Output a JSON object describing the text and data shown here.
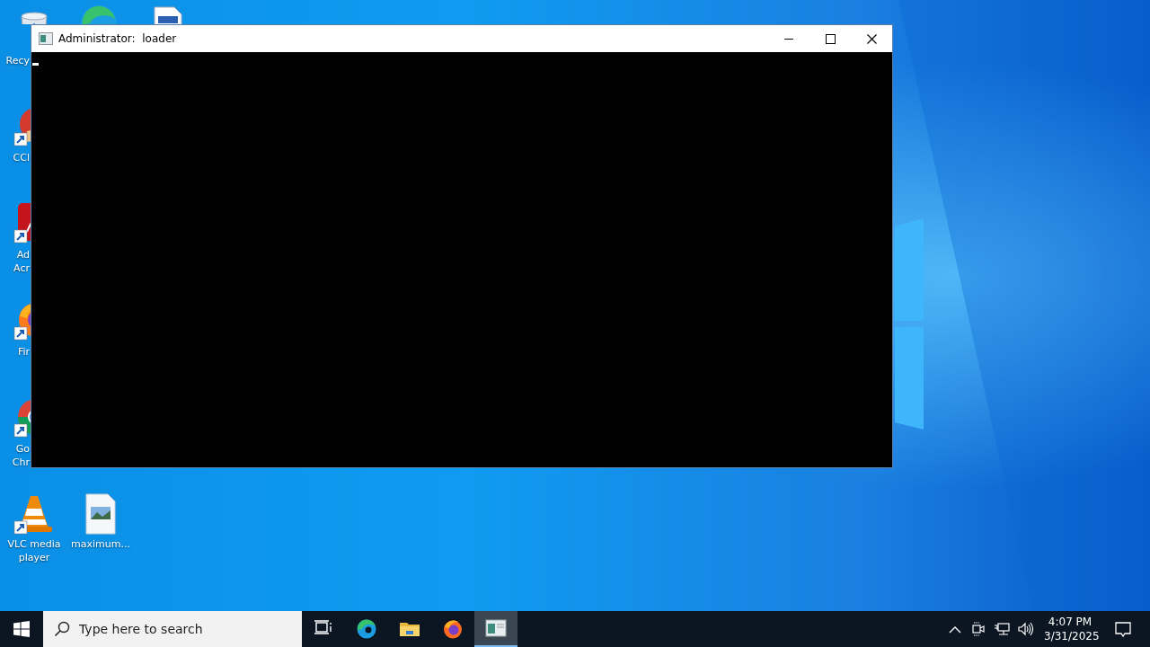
{
  "desktop_icons": [
    {
      "kind": "recycle-bin",
      "label_lines": [
        "Recy"
      ]
    },
    {
      "kind": "edge"
    },
    {
      "kind": "document"
    },
    {
      "kind": "ccleaner",
      "label_lines": [
        "CCl"
      ]
    },
    {
      "kind": "acrobat",
      "label_lines": [
        "Ad",
        "Acr"
      ]
    },
    {
      "kind": "firefox",
      "label_lines": [
        "Fir"
      ]
    },
    {
      "kind": "chrome",
      "label_lines": [
        "Go",
        "Chr"
      ]
    },
    {
      "kind": "vlc",
      "label_lines": [
        "VLC media",
        "player"
      ]
    },
    {
      "kind": "image-file",
      "label_lines": [
        "maximum..."
      ]
    }
  ],
  "window": {
    "title": "Administrator:  loader",
    "cursor": true
  },
  "taskbar": {
    "search": {
      "placeholder": "Type here to search"
    },
    "apps": [
      {
        "kind": "task-view",
        "selected": false
      },
      {
        "kind": "edge",
        "selected": false
      },
      {
        "kind": "explorer",
        "selected": false
      },
      {
        "kind": "firefox",
        "selected": false
      },
      {
        "kind": "console",
        "selected": true
      }
    ],
    "tray": {
      "time": "4:07 PM",
      "date": "3/31/2025"
    }
  }
}
